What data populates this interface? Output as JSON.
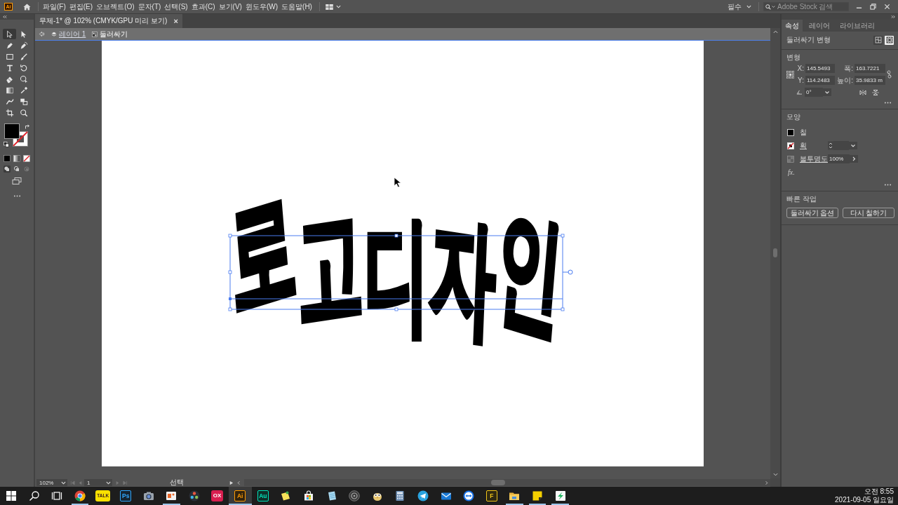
{
  "menu_bar": {
    "logo": "Ai",
    "menus": [
      "파일(F)",
      "편집(E)",
      "오브젝트(O)",
      "문자(T)",
      "선택(S)",
      "효과(C)",
      "보기(V)",
      "윈도우(W)",
      "도움말(H)"
    ],
    "workspace": "필수",
    "search": {
      "placeholder": "Adobe Stock 검색"
    }
  },
  "document_tabs": [
    {
      "title": "무제-1* @ 102% (CMYK/GPU 미리 보기)",
      "close": "×",
      "selected": true
    }
  ],
  "breadcrumb": {
    "layer": "레이어 1",
    "object": "둘러싸기"
  },
  "tools": [
    {
      "kind": "selection",
      "selected": true
    },
    {
      "kind": "direct-selection",
      "selected": false
    },
    {
      "kind": "pen",
      "selected": false
    },
    {
      "kind": "curvature",
      "selected": false
    },
    {
      "kind": "rectangle",
      "selected": false
    },
    {
      "kind": "brush",
      "selected": false
    },
    {
      "kind": "type",
      "selected": false
    },
    {
      "kind": "rotate",
      "selected": false
    },
    {
      "kind": "eraser",
      "selected": false
    },
    {
      "kind": "shape-builder",
      "selected": false
    },
    {
      "kind": "gradient",
      "selected": false
    },
    {
      "kind": "eyedropper",
      "selected": false
    },
    {
      "kind": "puppet-warp",
      "selected": false
    },
    {
      "kind": "blend",
      "selected": false
    },
    {
      "kind": "artboard",
      "selected": false
    },
    {
      "kind": "zoom",
      "selected": false
    }
  ],
  "artwork": {
    "text": "로고디자인",
    "selected": true
  },
  "status_bar": {
    "zoom": "102%",
    "artboard": "1",
    "tool": "선택"
  },
  "properties_panel": {
    "tabs": [
      {
        "label": "속성",
        "selected": true
      },
      {
        "label": "레이어",
        "selected": false
      },
      {
        "label": "라이브러리",
        "selected": false
      }
    ],
    "object_type": "둘러싸기 변형",
    "envelope_modes": [
      {
        "kind": "warp",
        "selected": false
      },
      {
        "kind": "mesh",
        "selected": true
      }
    ],
    "transform": {
      "title": "변형",
      "fields": [
        {
          "label": "X:",
          "value": "145.5493"
        },
        {
          "label": "폭:",
          "value": "163.7221"
        },
        {
          "label": "Y:",
          "value": "114.2483"
        },
        {
          "label": "높이:",
          "value": "35.9833 m"
        }
      ],
      "angle": "0°"
    },
    "appearance": {
      "title": "모양",
      "fill_label": "칠",
      "stroke_label": "획",
      "opacity_label": "불투명도",
      "opacity": "100%",
      "effects": "fx."
    },
    "quick_actions": {
      "title": "빠른 작업",
      "buttons": [
        "둘러싸기 옵션",
        "다시 칠하기"
      ]
    }
  },
  "taskbar": {
    "apps": [
      {
        "kind": "browser",
        "running": true,
        "selected": false
      },
      {
        "kind": "chat-tile",
        "label": "TALK",
        "running": false,
        "selected": false
      },
      {
        "kind": "letter-tile",
        "label": "Ps",
        "color": "#31a8ff",
        "running": false,
        "selected": false
      },
      {
        "kind": "camera",
        "running": false,
        "selected": false
      },
      {
        "kind": "slides",
        "running": true,
        "selected": false
      },
      {
        "kind": "wheel",
        "running": false,
        "selected": false
      },
      {
        "kind": "filled-tile",
        "label": "OX",
        "color": "#d81e4f",
        "running": false,
        "selected": false
      },
      {
        "kind": "letter-tile",
        "label": "Ai",
        "color": "#ff9a00",
        "running": true,
        "selected": true
      },
      {
        "kind": "letter-tile",
        "label": "Au",
        "color": "#00e4bb",
        "running": false,
        "selected": false
      },
      {
        "kind": "pin-note",
        "running": false,
        "selected": false
      },
      {
        "kind": "store",
        "running": false,
        "selected": false
      },
      {
        "kind": "notepad",
        "running": false,
        "selected": false
      },
      {
        "kind": "disc",
        "running": false,
        "selected": false
      },
      {
        "kind": "owl",
        "running": false,
        "selected": false
      },
      {
        "kind": "calculator",
        "running": false,
        "selected": false
      },
      {
        "kind": "telegram",
        "running": false,
        "selected": false
      },
      {
        "kind": "mail",
        "running": false,
        "selected": false
      },
      {
        "kind": "remote",
        "running": false,
        "selected": false
      },
      {
        "kind": "letter-tile",
        "label": "F",
        "color": "#f0c419",
        "running": false,
        "selected": false
      },
      {
        "kind": "folder",
        "running": true,
        "selected": false
      },
      {
        "kind": "sticky-note",
        "running": true,
        "selected": false
      },
      {
        "kind": "green-app",
        "running": true,
        "selected": false
      }
    ],
    "time": "오전 8:55",
    "date": "2021-09-05 일요일"
  }
}
